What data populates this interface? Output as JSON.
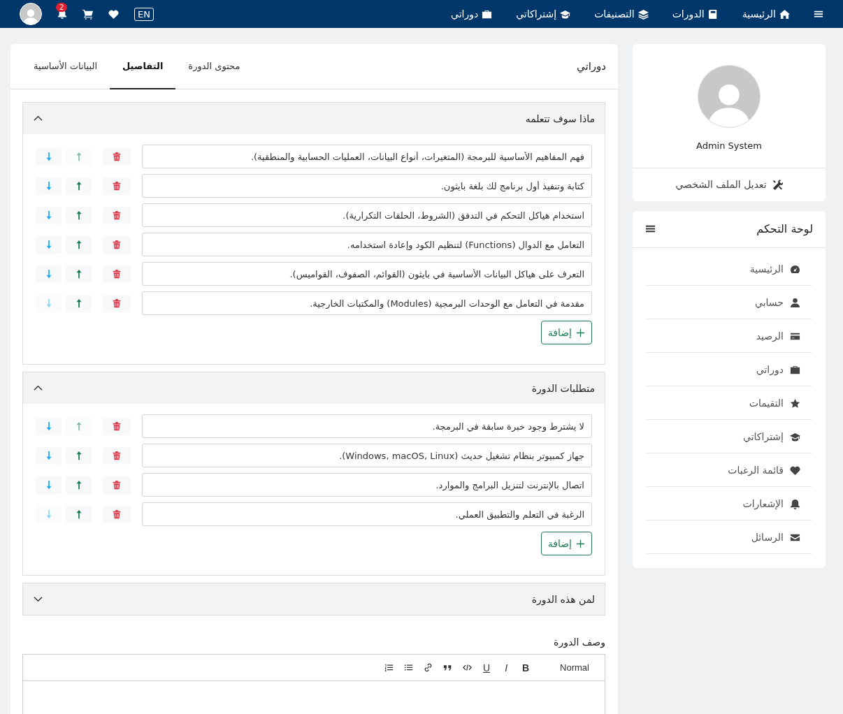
{
  "navbar": {
    "links": [
      {
        "label": "الرئيسية"
      },
      {
        "label": "الدورات"
      },
      {
        "label": "التصنيفات"
      },
      {
        "label": "إشتراكاتي"
      },
      {
        "label": "دوراتي"
      }
    ],
    "language": "EN",
    "notifications_count": "2"
  },
  "main": {
    "title": "دوراتي",
    "tabs": [
      {
        "label": "محتوى الدورة",
        "selected": false
      },
      {
        "label": "التفاصيل",
        "selected": true
      },
      {
        "label": "البيانات الأساسية",
        "selected": false
      }
    ],
    "sections": [
      {
        "title": "ماذا سوف تتعلمه",
        "expanded": true,
        "add_label": "إضافة",
        "items": [
          {
            "value": "فهم المفاهيم الأساسية للبرمجة (المتغيرات، أنواع البيانات، العمليات الحسابية والمنطقية).",
            "up_disabled": true,
            "down_disabled": false
          },
          {
            "value": "كتابة وتنفيذ أول برنامج لك بلغة بايثون.",
            "up_disabled": false,
            "down_disabled": false
          },
          {
            "value": "استخدام هياكل التحكم في التدفق (الشروط، الحلقات التكرارية).",
            "up_disabled": false,
            "down_disabled": false
          },
          {
            "value": "التعامل مع الدوال (Functions) لتنظيم الكود وإعادة استخدامه.",
            "up_disabled": false,
            "down_disabled": false
          },
          {
            "value": "التعرف على هياكل البيانات الأساسية في بايثون (القوائم، الصفوف، القواميس).",
            "up_disabled": false,
            "down_disabled": false
          },
          {
            "value": "مقدمة في التعامل مع الوحدات البرمجية (Modules) والمكتبات الخارجية.",
            "up_disabled": false,
            "down_disabled": true
          }
        ]
      },
      {
        "title": "متطلبات الدورة",
        "expanded": true,
        "add_label": "إضافة",
        "items": [
          {
            "value": "لا يشترط وجود خبرة سابقة في البرمجة.",
            "up_disabled": true,
            "down_disabled": false
          },
          {
            "value": "جهاز كمبيوتر بنظام تشغيل حديث (Windows, macOS, Linux).",
            "up_disabled": false,
            "down_disabled": false
          },
          {
            "value": "اتصال بالإنترنت لتنزيل البرامج والموارد.",
            "up_disabled": false,
            "down_disabled": false
          },
          {
            "value": "الرغبة في التعلم والتطبيق العملي.",
            "up_disabled": false,
            "down_disabled": true
          }
        ]
      },
      {
        "title": "لمن هذه الدورة",
        "expanded": false
      }
    ],
    "description": {
      "label": "وصف الدورة",
      "format": "Normal",
      "buttons": [
        "B",
        "I",
        "U"
      ]
    }
  },
  "profile": {
    "name": "Admin System",
    "edit_label": "تعديل الملف الشخصي"
  },
  "dashboard": {
    "title": "لوحة التحكم",
    "items": [
      {
        "label": "الرئيسية"
      },
      {
        "label": "حسابي"
      },
      {
        "label": "الرصيد"
      },
      {
        "label": "دوراتي"
      },
      {
        "label": "التقيمات"
      },
      {
        "label": "إشتراكاتي"
      },
      {
        "label": "قائمة الرغبات"
      },
      {
        "label": "الإشعارات"
      },
      {
        "label": "الرسائل"
      }
    ]
  }
}
